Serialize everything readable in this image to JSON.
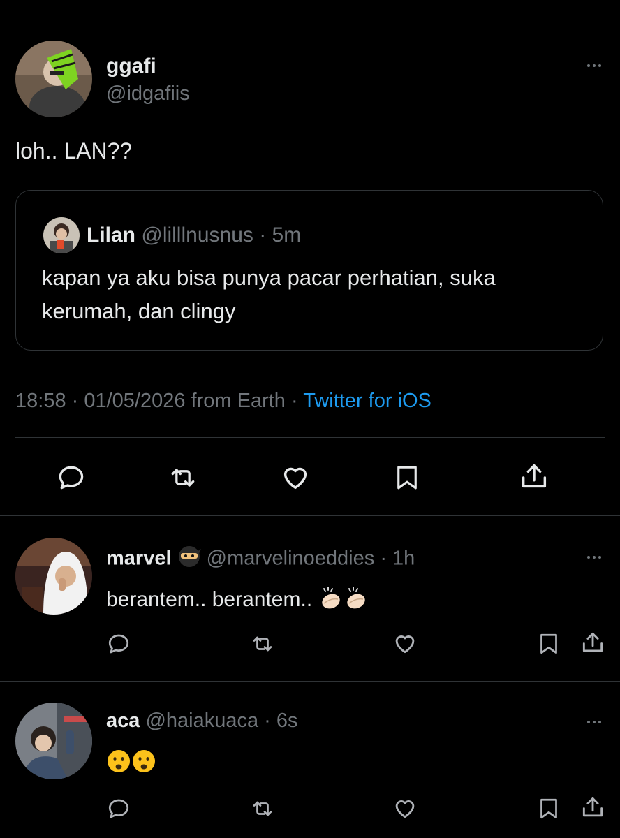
{
  "main_tweet": {
    "display_name": "ggafi",
    "handle": "@idgafiis",
    "text": "loh.. LAN??",
    "quote": {
      "display_name": "Lilan",
      "handle": "@lilllnusnus",
      "time": "· 5m",
      "text_line1": "kapan ya aku bisa punya pacar perhatian, suka",
      "text_line2": "kerumah, dan clingy"
    },
    "meta": {
      "time": "18:58 · 01/05/2026 from Earth ·",
      "source": "Twitter for iOS"
    },
    "actions": [
      "reply-icon",
      "retweet-icon",
      "like-icon",
      "bookmark-icon",
      "share-icon"
    ]
  },
  "replies": [
    {
      "display_name": "marvel",
      "badge": "ninja-emoji",
      "handle": "@marvelinoeddies",
      "time": "· 1h",
      "text": "berantem.. berantem..",
      "emojis": [
        "clapping-hands",
        "clapping-hands"
      ]
    },
    {
      "display_name": "aca",
      "handle": "@haiakuaca",
      "time": "· 6s",
      "text": "",
      "emojis": [
        "frowning-face",
        "frowning-face"
      ]
    }
  ],
  "colors": {
    "background": "#000000",
    "text": "#e7e9ea",
    "secondary": "#71767b",
    "link": "#1d9bf0",
    "border": "#2f3336"
  }
}
